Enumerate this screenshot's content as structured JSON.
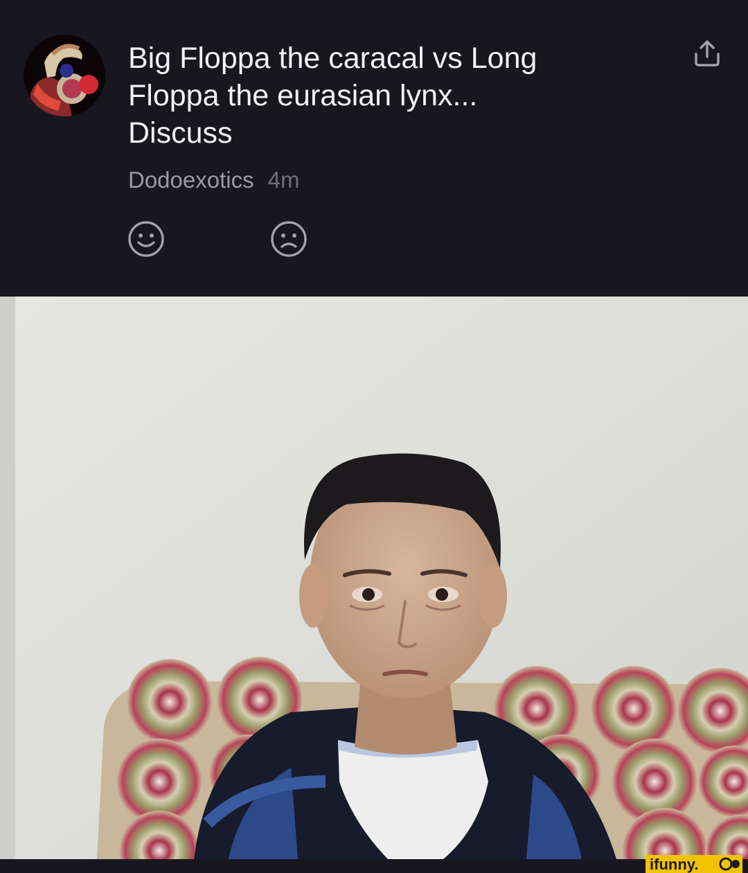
{
  "post": {
    "title": "Big Floppa the caracal vs Long\nFloppa the eurasian lynx...\nDiscuss",
    "author": "Dodoexotics",
    "time": "4m"
  },
  "icons": {
    "share": "share-icon",
    "like": "smile-icon",
    "dislike": "frown-icon"
  },
  "watermark": {
    "brand_text": "ifunny.co"
  },
  "colors": {
    "background": "#18171f",
    "title_text": "#f2f2f4",
    "author_text": "#9a9aa4",
    "time_text": "#6f6f78",
    "icon_gray": "#a2a2aa",
    "watermark_yellow": "#f2c300"
  }
}
